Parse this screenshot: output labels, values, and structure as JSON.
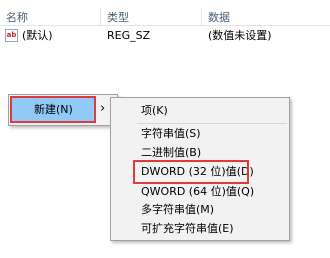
{
  "list": {
    "headers": {
      "name": "名称",
      "type": "类型",
      "data": "数据"
    },
    "rows": [
      {
        "icon": "ab",
        "name": "(默认)",
        "type": "REG_SZ",
        "data": "(数值未设置)"
      }
    ]
  },
  "context_menu": {
    "new_label": "新建(N)",
    "arrow": "›"
  },
  "submenu": {
    "key_label": "项(K)",
    "items": [
      "字符串值(S)",
      "二进制值(B)",
      "DWORD (32 位)值(D)",
      "QWORD (64 位)值(Q)",
      "多字符串值(M)",
      "可扩充字符串值(E)"
    ]
  },
  "colors": {
    "highlight": "#e03a3e",
    "menu_hover": "#91c9f7",
    "menu_bg": "#f2f2f2"
  }
}
